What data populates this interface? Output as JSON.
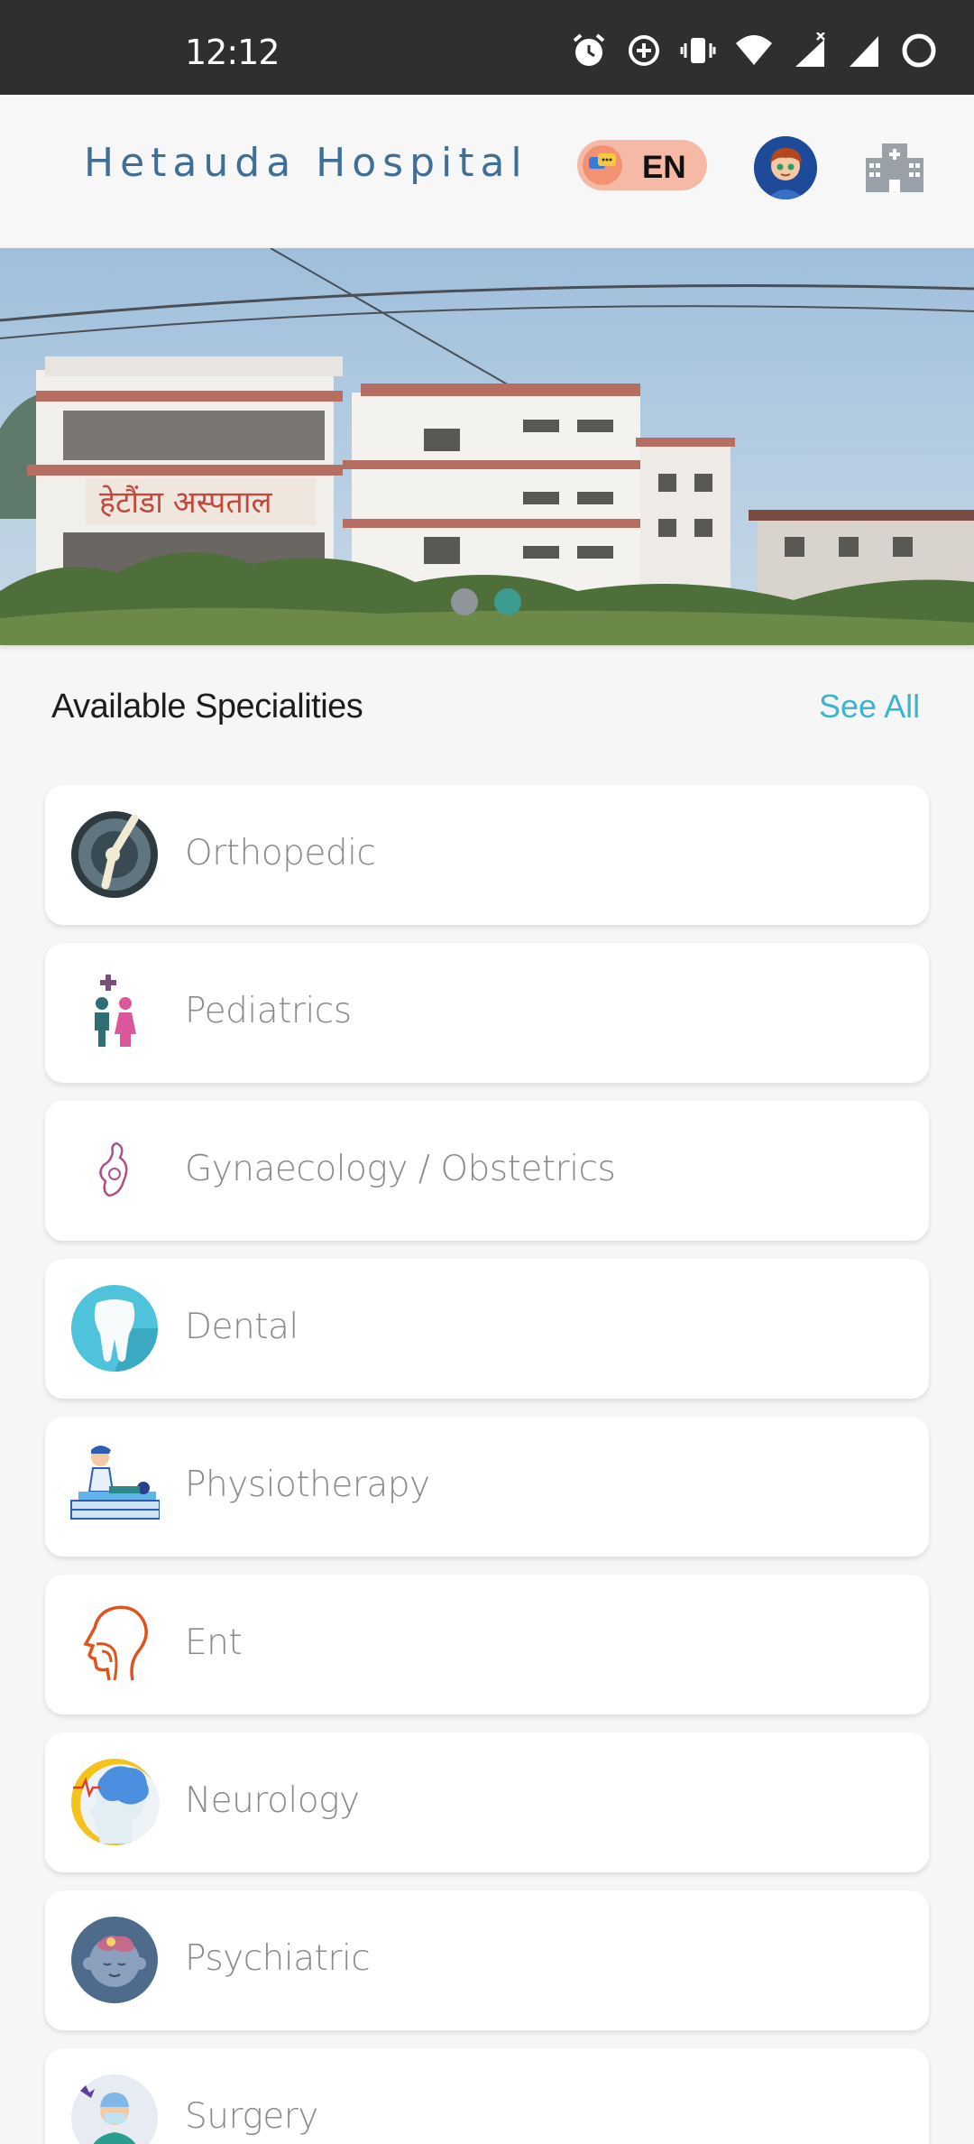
{
  "status_bar": {
    "time": "12:12",
    "icons": [
      "alarm-icon",
      "data-saver-icon",
      "vibrate-icon",
      "wifi-icon",
      "signal-x-icon",
      "signal-icon",
      "battery-ring-icon"
    ]
  },
  "header": {
    "title": "Hetauda Hospital",
    "language": "EN",
    "icons": [
      "chat-bubbles-icon",
      "avatar",
      "hospital-building-icon"
    ]
  },
  "banner": {
    "sign_text": "हेटौंडा अस्पताल",
    "slide_count": 2,
    "active_slide": 2
  },
  "specialities": {
    "title": "Available Specialities",
    "see_all": "See All",
    "items": [
      {
        "label": "Orthopedic",
        "icon": "orthopedic-joint-icon"
      },
      {
        "label": "Pediatrics",
        "icon": "children-icon"
      },
      {
        "label": "Gynaecology / Obstetrics",
        "icon": "mother-baby-icon"
      },
      {
        "label": "Dental",
        "icon": "tooth-icon"
      },
      {
        "label": "Physiotherapy",
        "icon": "physiotherapy-massage-icon"
      },
      {
        "label": "Ent",
        "icon": "ear-nose-throat-icon"
      },
      {
        "label": "Neurology",
        "icon": "brain-head-icon"
      },
      {
        "label": "Psychiatric",
        "icon": "mind-head-icon"
      },
      {
        "label": "Surgery",
        "icon": "surgeon-icon"
      }
    ]
  },
  "colors": {
    "status_bar": "#2f2f2f",
    "title_blue": "#3f6e96",
    "see_all": "#3cb4cf",
    "dot_active": "#3e9b8f",
    "dot_inactive": "#8f959a"
  }
}
